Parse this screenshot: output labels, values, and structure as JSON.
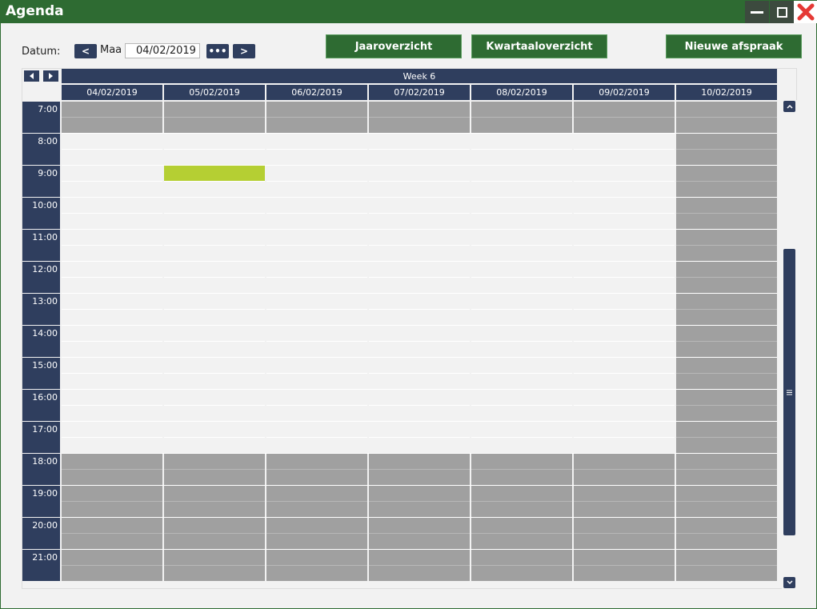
{
  "window": {
    "title": "Agenda",
    "controls": {
      "minimize": "minimize-icon",
      "maximize": "maximize-icon",
      "close": "close-icon"
    }
  },
  "toolbar": {
    "date_label": "Datum:",
    "prev_label": "<",
    "mode_label": "Maa",
    "date_value": "04/02/2019",
    "picker_label": "•••",
    "next_label": ">",
    "year_button": "Jaaroverzicht",
    "quarter_button": "Kwartaaloverzicht",
    "new_button": "Nieuwe afspraak"
  },
  "calendar": {
    "week_label": "Week 6",
    "days": [
      "04/02/2019",
      "05/02/2019",
      "06/02/2019",
      "07/02/2019",
      "08/02/2019",
      "09/02/2019",
      "10/02/2019"
    ],
    "hours": [
      "7:00",
      "8:00",
      "9:00",
      "10:00",
      "11:00",
      "12:00",
      "13:00",
      "14:00",
      "15:00",
      "16:00",
      "17:00",
      "18:00",
      "19:00",
      "20:00",
      "21:00"
    ],
    "open_from_hour": "8:00",
    "open_until_hour": "18:00",
    "closed_days": [
      "10/02/2019"
    ],
    "events": [
      {
        "day": "05/02/2019",
        "start": "9:00",
        "end": "9:30",
        "color": "#b5cf33"
      }
    ]
  },
  "colors": {
    "titlebar": "#2e6b32",
    "header": "#2f3e5e",
    "closed_slot": "#a0a0a0",
    "open_slot": "#f2f2f2",
    "event": "#b5cf33",
    "close_icon": "#e53935"
  }
}
